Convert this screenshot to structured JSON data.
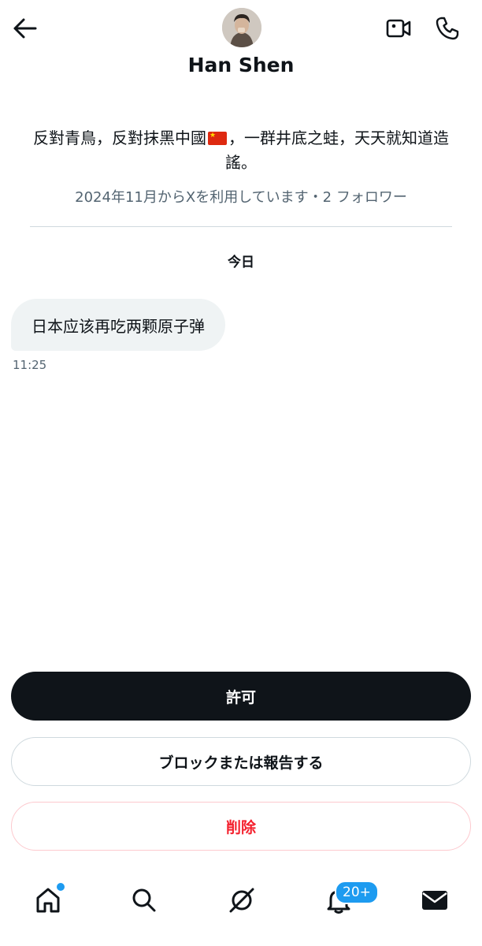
{
  "header": {
    "back_icon": "arrow-left-icon",
    "video_icon": "video-camera-icon",
    "call_icon": "phone-icon",
    "display_name": "Han Shen"
  },
  "profile": {
    "bio_part1": "反對青鳥，反對抹黑中國",
    "bio_flag": "china-flag-emoji",
    "bio_part2": "，一群井底之蛙，天天就知道造謠。",
    "meta": "2024年11月からXを利用しています・2 フォロワー"
  },
  "conversation": {
    "date_label": "今日",
    "messages": [
      {
        "text": "日本应该再吃两颗原子弹",
        "time": "11:25"
      }
    ]
  },
  "actions": {
    "allow_label": "許可",
    "block_label": "ブロックまたは報告する",
    "delete_label": "削除"
  },
  "bottom_nav": {
    "items": [
      "home-icon",
      "search-icon",
      "grok-icon",
      "bell-icon",
      "mail-icon"
    ],
    "notifications_badge": "20+",
    "accent_color": "#1d9bf0",
    "danger_color": "#f4212e"
  }
}
